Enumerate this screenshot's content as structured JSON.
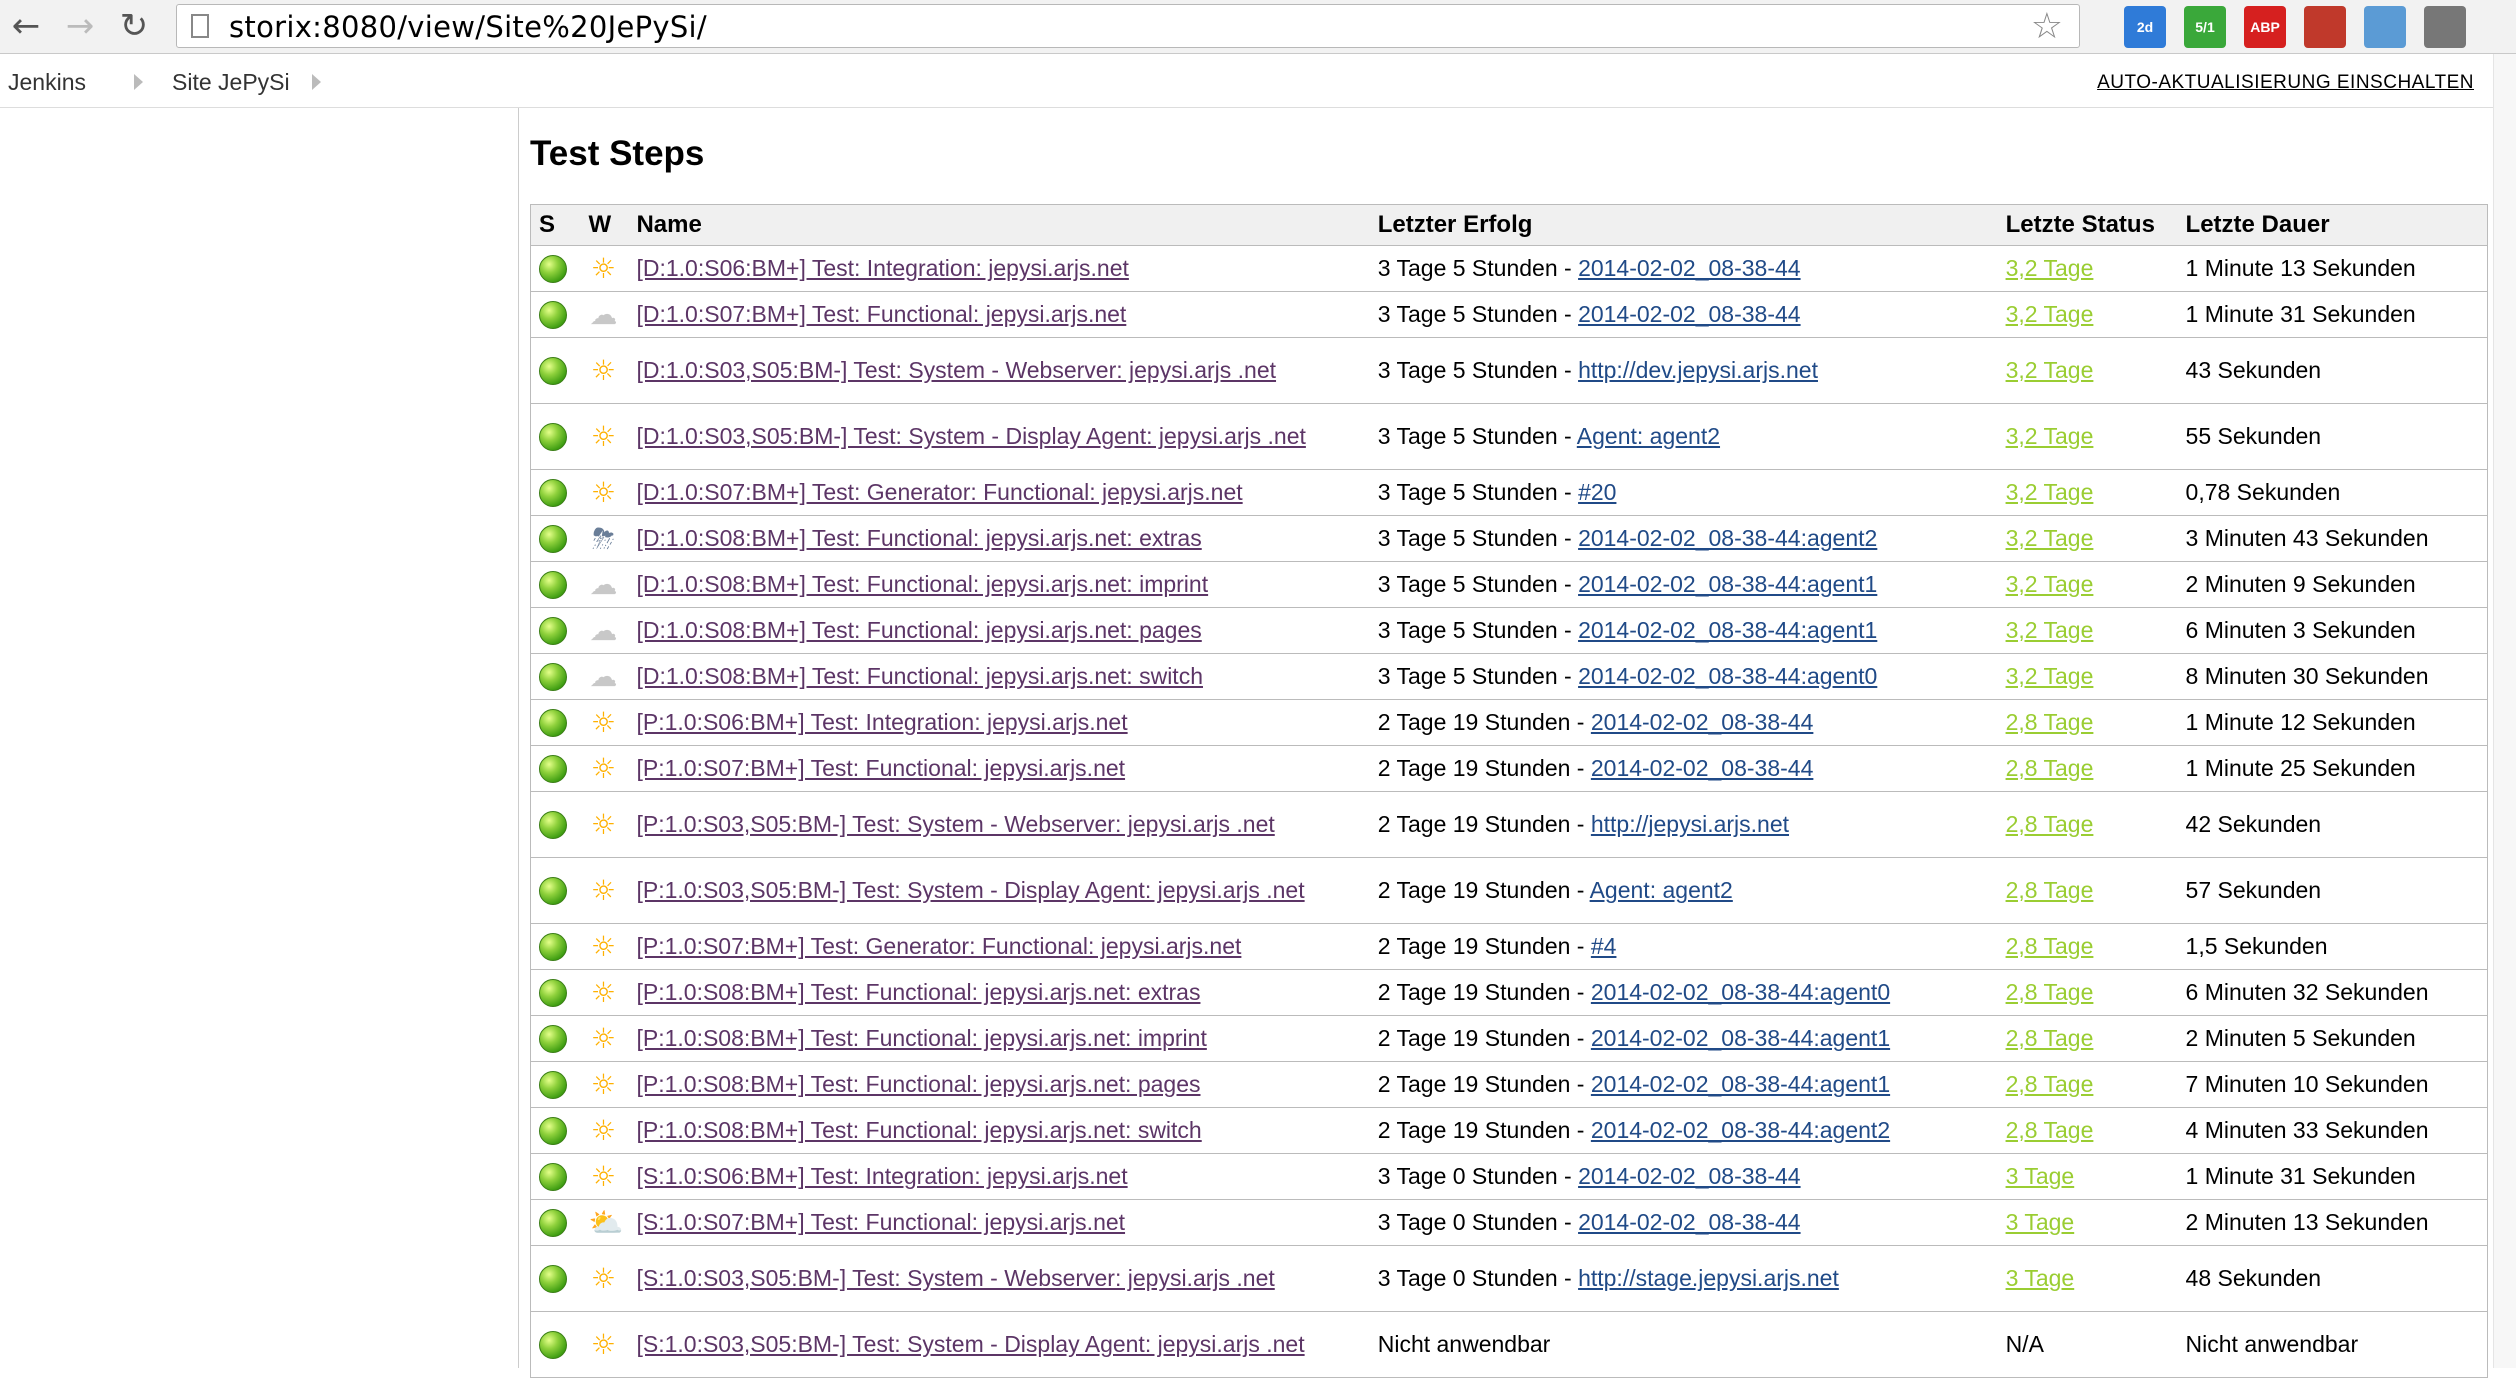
{
  "browser": {
    "url": "storix:8080/view/Site%20JePySi/",
    "extensions": [
      {
        "name": "calendar-extension-icon",
        "badge": "2d",
        "color": "#2f7bd8"
      },
      {
        "name": "mail-extension-icon",
        "badge": "5/1",
        "color": "#3aa83a"
      },
      {
        "name": "adblock-extension-icon",
        "badge": "ABP",
        "color": "#d6201f"
      },
      {
        "name": "bookmark-extension-icon",
        "badge": "",
        "color": "#c0392b"
      },
      {
        "name": "window-extension-icon",
        "badge": "",
        "color": "#5b9bd5"
      },
      {
        "name": "sync-extension-icon",
        "badge": "",
        "color": "#777777"
      }
    ]
  },
  "breadcrumb": {
    "items": [
      "Jenkins",
      "Site JePySi"
    ],
    "auto_refresh": "AUTO-AKTUALISIERUNG EINSCHALTEN"
  },
  "main": {
    "title": "Test Steps",
    "columns": {
      "s": "S",
      "w": "W",
      "name": "Name",
      "last_success": "Letzter Erfolg",
      "last_status": "Letzte Status",
      "last_duration": "Letzte Dauer"
    },
    "rows": [
      {
        "weather": "sunny",
        "name": "[D:1.0:S06:BM+] Test: Integration: jepysi.arjs.net",
        "success_prefix": "3 Tage 5 Stunden - ",
        "success_link": "2014-02-02_08-38-44",
        "status": "3,2 Tage",
        "duration": "1 Minute 13 Sekunden"
      },
      {
        "weather": "cloudy",
        "name": "[D:1.0:S07:BM+] Test: Functional: jepysi.arjs.net",
        "success_prefix": "3 Tage 5 Stunden - ",
        "success_link": "2014-02-02_08-38-44",
        "status": "3,2 Tage",
        "duration": "1 Minute 31 Sekunden"
      },
      {
        "weather": "sunny",
        "name": "[D:1.0:S03,S05:BM-] Test: System - Webserver: jepysi.arjs .net",
        "success_prefix": "3 Tage 5 Stunden - ",
        "success_link": "http://dev.jepysi.arjs.net",
        "status": "3,2 Tage",
        "duration": "43 Sekunden"
      },
      {
        "weather": "sunny",
        "name": "[D:1.0:S03,S05:BM-] Test: System - Display Agent: jepysi.arjs .net",
        "success_prefix": "3 Tage 5 Stunden - ",
        "success_link": "Agent: agent2",
        "status": "3,2 Tage",
        "duration": "55 Sekunden"
      },
      {
        "weather": "sunny",
        "name": "[D:1.0:S07:BM+] Test: Generator: Functional: jepysi.arjs.net",
        "success_prefix": "3 Tage 5 Stunden - ",
        "success_link": "#20",
        "status": "3,2 Tage",
        "duration": "0,78 Sekunden"
      },
      {
        "weather": "rain",
        "name": "[D:1.0:S08:BM+] Test: Functional: jepysi.arjs.net: extras",
        "success_prefix": "3 Tage 5 Stunden - ",
        "success_link": "2014-02-02_08-38-44:agent2",
        "status": "3,2 Tage",
        "duration": "3 Minuten 43 Sekunden"
      },
      {
        "weather": "cloudy",
        "name": "[D:1.0:S08:BM+] Test: Functional: jepysi.arjs.net: imprint",
        "success_prefix": "3 Tage 5 Stunden - ",
        "success_link": "2014-02-02_08-38-44:agent1",
        "status": "3,2 Tage",
        "duration": "2 Minuten 9 Sekunden"
      },
      {
        "weather": "cloudy",
        "name": "[D:1.0:S08:BM+] Test: Functional: jepysi.arjs.net: pages",
        "success_prefix": "3 Tage 5 Stunden - ",
        "success_link": "2014-02-02_08-38-44:agent1",
        "status": "3,2 Tage",
        "duration": "6 Minuten 3 Sekunden"
      },
      {
        "weather": "cloudy",
        "name": "[D:1.0:S08:BM+] Test: Functional: jepysi.arjs.net: switch",
        "success_prefix": "3 Tage 5 Stunden - ",
        "success_link": "2014-02-02_08-38-44:agent0",
        "status": "3,2 Tage",
        "duration": "8 Minuten 30 Sekunden"
      },
      {
        "weather": "sunny",
        "name": "[P:1.0:S06:BM+] Test: Integration: jepysi.arjs.net",
        "success_prefix": "2 Tage 19 Stunden - ",
        "success_link": "2014-02-02_08-38-44",
        "status": "2,8 Tage",
        "duration": "1 Minute 12 Sekunden"
      },
      {
        "weather": "sunny",
        "name": "[P:1.0:S07:BM+] Test: Functional: jepysi.arjs.net",
        "success_prefix": "2 Tage 19 Stunden - ",
        "success_link": "2014-02-02_08-38-44",
        "status": "2,8 Tage",
        "duration": "1 Minute 25 Sekunden"
      },
      {
        "weather": "sunny",
        "name": "[P:1.0:S03,S05:BM-] Test: System - Webserver: jepysi.arjs .net",
        "success_prefix": "2 Tage 19 Stunden - ",
        "success_link": "http://jepysi.arjs.net",
        "status": "2,8 Tage",
        "duration": "42 Sekunden"
      },
      {
        "weather": "sunny",
        "name": "[P:1.0:S03,S05:BM-] Test: System - Display Agent: jepysi.arjs .net",
        "success_prefix": "2 Tage 19 Stunden - ",
        "success_link": "Agent: agent2",
        "status": "2,8 Tage",
        "duration": "57 Sekunden"
      },
      {
        "weather": "sunny",
        "name": "[P:1.0:S07:BM+] Test: Generator: Functional: jepysi.arjs.net",
        "success_prefix": "2 Tage 19 Stunden - ",
        "success_link": "#4",
        "status": "2,8 Tage",
        "duration": "1,5 Sekunden"
      },
      {
        "weather": "sunny",
        "name": "[P:1.0:S08:BM+] Test: Functional: jepysi.arjs.net: extras",
        "success_prefix": "2 Tage 19 Stunden - ",
        "success_link": "2014-02-02_08-38-44:agent0",
        "status": "2,8 Tage",
        "duration": "6 Minuten 32 Sekunden"
      },
      {
        "weather": "sunny",
        "name": "[P:1.0:S08:BM+] Test: Functional: jepysi.arjs.net: imprint",
        "success_prefix": "2 Tage 19 Stunden - ",
        "success_link": "2014-02-02_08-38-44:agent1",
        "status": "2,8 Tage",
        "duration": "2 Minuten 5 Sekunden"
      },
      {
        "weather": "sunny",
        "name": "[P:1.0:S08:BM+] Test: Functional: jepysi.arjs.net: pages",
        "success_prefix": "2 Tage 19 Stunden - ",
        "success_link": "2014-02-02_08-38-44:agent1",
        "status": "2,8 Tage",
        "duration": "7 Minuten 10 Sekunden"
      },
      {
        "weather": "sunny",
        "name": "[P:1.0:S08:BM+] Test: Functional: jepysi.arjs.net: switch",
        "success_prefix": "2 Tage 19 Stunden - ",
        "success_link": "2014-02-02_08-38-44:agent2",
        "status": "2,8 Tage",
        "duration": "4 Minuten 33 Sekunden"
      },
      {
        "weather": "sunny",
        "name": "[S:1.0:S06:BM+] Test: Integration: jepysi.arjs.net",
        "success_prefix": "3 Tage 0 Stunden - ",
        "success_link": "2014-02-02_08-38-44",
        "status": "3 Tage",
        "duration": "1 Minute 31 Sekunden"
      },
      {
        "weather": "partly",
        "name": "[S:1.0:S07:BM+] Test: Functional: jepysi.arjs.net",
        "success_prefix": "3 Tage 0 Stunden - ",
        "success_link": "2014-02-02_08-38-44",
        "status": "3 Tage",
        "duration": "2 Minuten 13 Sekunden"
      },
      {
        "weather": "sunny",
        "name": "[S:1.0:S03,S05:BM-] Test: System - Webserver: jepysi.arjs .net",
        "success_prefix": "3 Tage 0 Stunden - ",
        "success_link": "http://stage.jepysi.arjs.net",
        "status": "3 Tage",
        "duration": "48 Sekunden"
      },
      {
        "weather": "sunny",
        "name": "[S:1.0:S03,S05:BM-] Test: System - Display Agent: jepysi.arjs .net",
        "success_prefix": "Nicht anwendbar",
        "success_link": "",
        "status": "N/A",
        "status_plain": true,
        "duration": "Nicht anwendbar"
      }
    ]
  }
}
